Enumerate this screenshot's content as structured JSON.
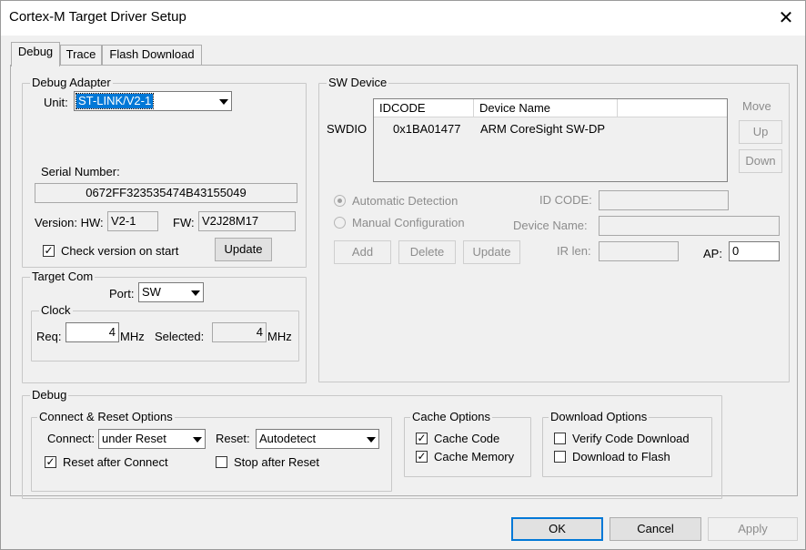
{
  "window": {
    "title": "Cortex-M Target Driver Setup",
    "close_glyph": "✕"
  },
  "tabs": [
    {
      "label": "Debug"
    },
    {
      "label": "Trace"
    },
    {
      "label": "Flash Download"
    }
  ],
  "debug_adapter": {
    "group_label": "Debug Adapter",
    "unit_label": "Unit:",
    "unit_value": "ST-LINK/V2-1",
    "serial_label": "Serial Number:",
    "serial_value": "0672FF323535474B43155049",
    "version_hw_label": "Version: HW:",
    "hw_value": "V2-1",
    "fw_label": "FW:",
    "fw_value": "V2J28M17",
    "check_version_label": "Check version on start",
    "check_version_checked": true,
    "update_button": "Update"
  },
  "target_com": {
    "group_label": "Target Com",
    "port_label": "Port:",
    "port_value": "SW",
    "clock": {
      "group_label": "Clock",
      "req_label": "Req:",
      "req_value": "4",
      "req_unit": "MHz",
      "selected_label": "Selected:",
      "selected_value": "4",
      "selected_unit": "MHz"
    }
  },
  "sw_device": {
    "group_label": "SW Device",
    "row_label": "SWDIO",
    "columns": [
      "IDCODE",
      "Device Name"
    ],
    "rows": [
      {
        "idcode": "0x1BA01477",
        "device_name": "ARM CoreSight SW-DP"
      }
    ],
    "move_label": "Move",
    "up_button": "Up",
    "down_button": "Down",
    "automatic_detection": "Automatic Detection",
    "manual_configuration": "Manual Configuration",
    "id_code_label": "ID CODE:",
    "device_name_label": "Device Name:",
    "ir_len_label": "IR len:",
    "ap_label": "AP:",
    "ap_value": "0",
    "add_button": "Add",
    "delete_button": "Delete",
    "update_button": "Update"
  },
  "debug": {
    "group_label": "Debug",
    "connect_reset": {
      "group_label": "Connect & Reset Options",
      "connect_label": "Connect:",
      "connect_value": "under Reset",
      "reset_label": "Reset:",
      "reset_value": "Autodetect",
      "reset_after_connect": "Reset after Connect",
      "reset_after_connect_checked": true,
      "stop_after_reset": "Stop after Reset",
      "stop_after_reset_checked": false
    },
    "cache_options": {
      "group_label": "Cache Options",
      "cache_code": "Cache Code",
      "cache_code_checked": true,
      "cache_memory": "Cache Memory",
      "cache_memory_checked": true
    },
    "download_options": {
      "group_label": "Download Options",
      "verify_code_download": "Verify Code Download",
      "verify_checked": false,
      "download_to_flash": "Download to Flash",
      "download_checked": false
    }
  },
  "footer": {
    "ok": "OK",
    "cancel": "Cancel",
    "apply": "Apply"
  },
  "colors": {
    "accent": "#0078d7",
    "disabled_text": "#8c8c8c"
  }
}
